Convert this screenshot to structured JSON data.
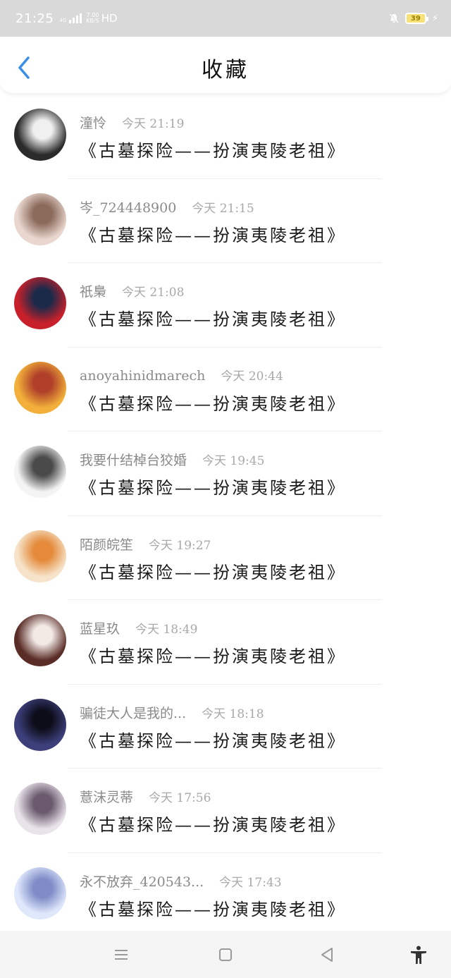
{
  "status_bar": {
    "time": "21:25",
    "network_tag": "4G",
    "speed_value": "7.00",
    "speed_unit": "KB/S",
    "hd_label": "HD",
    "battery_level": "39"
  },
  "header": {
    "title": "收藏"
  },
  "favorites": [
    {
      "name": "潼怜",
      "time": "今天 21:19",
      "title": "《古墓探险——扮演夷陵老祖》"
    },
    {
      "name": "岑_724448900",
      "time": "今天 21:15",
      "title": "《古墓探险——扮演夷陵老祖》"
    },
    {
      "name": "祇梟",
      "time": "今天 21:08",
      "title": "《古墓探险——扮演夷陵老祖》"
    },
    {
      "name": "anoyahinidmarech",
      "time": "今天 20:44",
      "title": "《古墓探险——扮演夷陵老祖》"
    },
    {
      "name": "我要什结棹台狡婚",
      "time": "今天 19:45",
      "title": "《古墓探险——扮演夷陵老祖》"
    },
    {
      "name": "陌颜皖笙",
      "time": "今天 19:27",
      "title": "《古墓探险——扮演夷陵老祖》"
    },
    {
      "name": "蓝星玖",
      "time": "今天 18:49",
      "title": "《古墓探险——扮演夷陵老祖》"
    },
    {
      "name": "骗徒大人是我的...",
      "time": "今天 18:18",
      "title": "《古墓探险——扮演夷陵老祖》"
    },
    {
      "name": "薏沫灵蒂",
      "time": "今天 17:56",
      "title": "《古墓探险——扮演夷陵老祖》"
    },
    {
      "name": "永不放弃_420543...",
      "time": "今天 17:43",
      "title": "《古墓探险——扮演夷陵老祖》"
    }
  ],
  "avatar_colors": [
    [
      "#2b2b2b",
      "#f0f0f0"
    ],
    [
      "#e8d6cf",
      "#8b6a5a"
    ],
    [
      "#c8202a",
      "#1c2a4a"
    ],
    [
      "#f2b03a",
      "#b0402a"
    ],
    [
      "#f4f4f4",
      "#4a4a4a"
    ],
    [
      "#f6e3c9",
      "#e48a3a"
    ],
    [
      "#5a2c26",
      "#f3eae6"
    ],
    [
      "#3c3f7a",
      "#0d0d1a"
    ],
    [
      "#e9e3ea",
      "#6b5a6e"
    ],
    [
      "#dfe7fb",
      "#7f8cc7"
    ]
  ],
  "colors": {
    "accent_back": "#3a8ee6",
    "nav_icons": "#9a9a9a"
  }
}
